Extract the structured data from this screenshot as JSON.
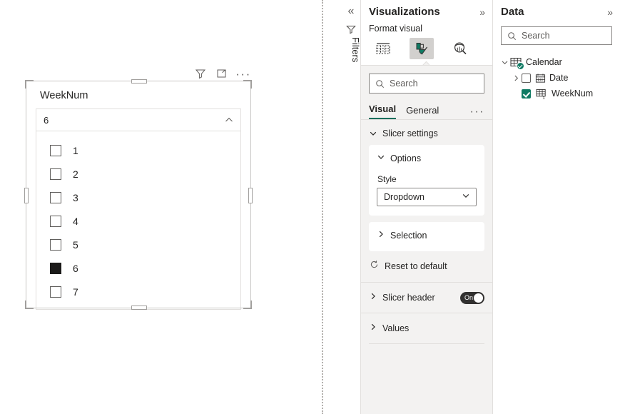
{
  "canvas": {
    "visual_header": {
      "filter_icon": "filter-icon",
      "focus_icon": "focus-mode-icon",
      "more_label": "···"
    },
    "slicer": {
      "title": "WeekNum",
      "selected_value": "6",
      "chevron": "chevron-up-icon",
      "items": [
        {
          "label": "1",
          "checked": false
        },
        {
          "label": "2",
          "checked": false
        },
        {
          "label": "3",
          "checked": false
        },
        {
          "label": "4",
          "checked": false
        },
        {
          "label": "5",
          "checked": false
        },
        {
          "label": "6",
          "checked": true
        },
        {
          "label": "7",
          "checked": false
        }
      ]
    }
  },
  "filters_rail": {
    "collapse_label": "«",
    "icon": "filter-icon",
    "label": "Filters"
  },
  "visualizations": {
    "title": "Visualizations",
    "expand_label": "»",
    "format_visual_label": "Format visual",
    "icons": [
      {
        "name": "build-visual-icon",
        "selected": false
      },
      {
        "name": "format-visual-icon",
        "selected": true
      },
      {
        "name": "analytics-icon",
        "selected": false
      }
    ],
    "search": {
      "placeholder": "Search",
      "value": ""
    },
    "tabs": [
      {
        "label": "Visual",
        "active": true
      },
      {
        "label": "General",
        "active": false
      }
    ],
    "tabs_more": "···",
    "slicer_settings": {
      "label": "Slicer settings",
      "expanded": true,
      "options_card": {
        "label": "Options",
        "expanded": true,
        "style_label": "Style",
        "style_value": "Dropdown"
      },
      "selection_card": {
        "label": "Selection",
        "expanded": false
      },
      "reset_label": "Reset to default"
    },
    "rows": [
      {
        "label": "Slicer header",
        "toggle": "On",
        "has_toggle": true
      },
      {
        "label": "Values",
        "toggle": "",
        "has_toggle": false
      }
    ]
  },
  "data_pane": {
    "title": "Data",
    "expand_label": "»",
    "search": {
      "placeholder": "Search",
      "value": ""
    },
    "tree": [
      {
        "label": "Calendar",
        "type": "table",
        "expanded": true,
        "badge": true,
        "indent": 0
      },
      {
        "label": "Date",
        "type": "date-field",
        "checked": false,
        "indent": 1,
        "has_twisty": true
      },
      {
        "label": "WeekNum",
        "type": "measure-field",
        "checked": true,
        "indent": 2,
        "has_twisty": false
      }
    ]
  },
  "colors": {
    "accent_teal": "#0f7a63",
    "tab_underline": "#0f6f5c",
    "checked_slicer": "#1b1a19",
    "pane_bg": "#f3f2f1",
    "border": "#e1dfdd"
  }
}
